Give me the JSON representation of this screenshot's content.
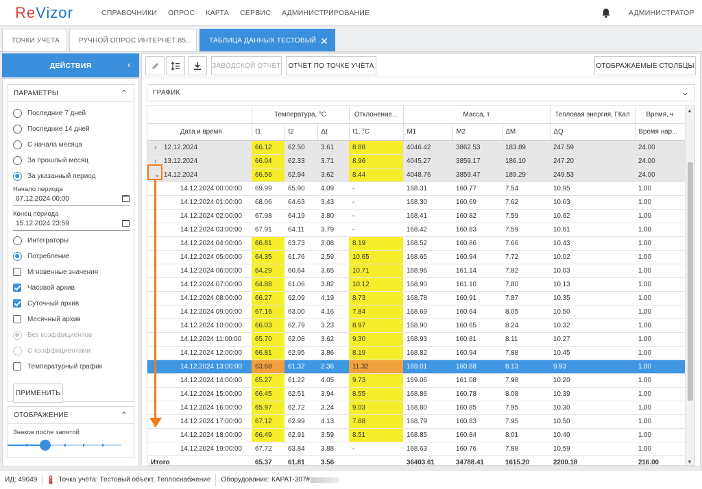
{
  "app": {
    "logo_re": "Re",
    "logo_rest": "Vizor"
  },
  "nav": [
    "СПРАВОЧНИКИ",
    "ОПРОС",
    "КАРТА",
    "СЕРВИС",
    "АДМИНИСТРИРОВАНИЕ"
  ],
  "user": "АДМИНИСТРАТОР",
  "tabs": [
    {
      "label": "ТОЧКИ УЧЕТА"
    },
    {
      "label": "РУЧНОЙ ОПРОС ИНТЕРНЕТ 85..."
    },
    {
      "label": "ТАБЛИЦА ДАННЫХ ТЕСТОВЫЙ ...",
      "active": true
    }
  ],
  "sidebar": {
    "actions_label": "ДЕЙСТВИЯ",
    "params_title": "ПАРАМЕТРЫ",
    "periods": [
      "Последние 7 дней",
      "Последние 14 дней",
      "С начала месяца",
      "За прошлый месяц",
      "За указанный период"
    ],
    "selected_period": 4,
    "start_label": "Начало периода",
    "start_value": "07.12.2024 00:00",
    "end_label": "Конец периода",
    "end_value": "15.12.2024 23:59",
    "mode_options": [
      "Интеграторы",
      "Потребление"
    ],
    "selected_mode": 1,
    "checks": [
      {
        "label": "Мгновенные значения",
        "checked": false
      },
      {
        "label": "Часовой архив",
        "checked": true
      },
      {
        "label": "Суточный архив",
        "checked": true
      },
      {
        "label": "Месячный архив",
        "checked": false
      }
    ],
    "coef_options": [
      "Без коэффициентов",
      "С коэффициентами"
    ],
    "temp_graph_label": "Температурный график",
    "apply_label": "ПРИМЕНИТЬ",
    "display_title": "ОТОБРАЖЕНИЕ",
    "decimals_label": "Знаков после запятой",
    "decimals_slider_fraction": 0.33
  },
  "toolbar": {
    "factory_report": "ЗАВОДСКОЙ ОТЧЁТ",
    "point_report": "ОТЧЁТ ПО ТОЧКЕ УЧЁТА",
    "columns": "ОТОБРАЖАЕМЫЕ СТОЛБЦЫ"
  },
  "grafik_label": "ГРАФИК",
  "table": {
    "group_headers": [
      "",
      "Температура, °C",
      "Отклонение...",
      "Масса, т",
      "Тепловая энергия, ГКал",
      "Время, ч"
    ],
    "columns": [
      "Дата и время",
      "t1",
      "t2",
      "Δt",
      "t1, °C",
      "M1",
      "M2",
      "ΔM",
      "ΔQ",
      "Время нар..."
    ],
    "groups": [
      {
        "date": "12.12.2024",
        "expander": "›",
        "vals": [
          "66.12",
          "62.50",
          "3.61",
          "8.88",
          "4046.42",
          "3862.53",
          "183.89",
          "247.59",
          "24.00"
        ]
      },
      {
        "date": "13.12.2024",
        "expander": "›",
        "vals": [
          "66.04",
          "62.33",
          "3.71",
          "8.96",
          "4045.27",
          "3859.17",
          "186.10",
          "247.20",
          "24.00"
        ]
      },
      {
        "date": "14.12.2024",
        "expander": "⌄",
        "vals": [
          "66.56",
          "62.94",
          "3.62",
          "8.44",
          "4048.76",
          "3859.47",
          "189.29",
          "249.53",
          "24.00"
        ]
      }
    ],
    "rows": [
      {
        "dt": "14.12.2024 00:00:00",
        "vals": [
          "69.99",
          "65.90",
          "4.09",
          "-",
          "168.31",
          "160.77",
          "7.54",
          "10.95",
          "1.00"
        ],
        "hl": false
      },
      {
        "dt": "14.12.2024 01:00:00",
        "vals": [
          "68.06",
          "64.63",
          "3.43",
          "-",
          "168.30",
          "160.69",
          "7.62",
          "10.63",
          "1.00"
        ],
        "hl": false
      },
      {
        "dt": "14.12.2024 02:00:00",
        "vals": [
          "67.98",
          "64.19",
          "3.80",
          "-",
          "168.41",
          "160.82",
          "7.59",
          "10.62",
          "1.00"
        ],
        "hl": false
      },
      {
        "dt": "14.12.2024 03:00:00",
        "vals": [
          "67.91",
          "64.11",
          "3.79",
          "-",
          "168.42",
          "160.83",
          "7.59",
          "10.61",
          "1.00"
        ],
        "hl": false
      },
      {
        "dt": "14.12.2024 04:00:00",
        "vals": [
          "66.81",
          "63.73",
          "3.08",
          "8.19",
          "168.52",
          "160.86",
          "7.66",
          "10.43",
          "1.00"
        ],
        "hl": true
      },
      {
        "dt": "14.12.2024 05:00:00",
        "vals": [
          "64.35",
          "61.76",
          "2.59",
          "10.65",
          "168.65",
          "160.94",
          "7.72",
          "10.02",
          "1.00"
        ],
        "hl": true
      },
      {
        "dt": "14.12.2024 06:00:00",
        "vals": [
          "64.29",
          "60.64",
          "3.65",
          "10.71",
          "168.96",
          "161.14",
          "7.82",
          "10.03",
          "1.00"
        ],
        "hl": true
      },
      {
        "dt": "14.12.2024 07:00:00",
        "vals": [
          "64.88",
          "61.06",
          "3.82",
          "10.12",
          "168.90",
          "161.10",
          "7.80",
          "10.13",
          "1.00"
        ],
        "hl": true
      },
      {
        "dt": "14.12.2024 08:00:00",
        "vals": [
          "66.27",
          "62.09",
          "4.19",
          "8.73",
          "168.78",
          "160.91",
          "7.87",
          "10.35",
          "1.00"
        ],
        "hl": true
      },
      {
        "dt": "14.12.2024 09:00:00",
        "vals": [
          "67.16",
          "63.00",
          "4.16",
          "7.84",
          "168.69",
          "160.64",
          "8.05",
          "10.50",
          "1.00"
        ],
        "hl": true
      },
      {
        "dt": "14.12.2024 10:00:00",
        "vals": [
          "66.03",
          "62.79",
          "3.23",
          "8.97",
          "168.90",
          "160.65",
          "8.24",
          "10.32",
          "1.00"
        ],
        "hl": true
      },
      {
        "dt": "14.12.2024 11:00:00",
        "vals": [
          "65.70",
          "62.08",
          "3.62",
          "9.30",
          "168.93",
          "160.81",
          "8.11",
          "10.27",
          "1.00"
        ],
        "hl": true
      },
      {
        "dt": "14.12.2024 12:00:00",
        "vals": [
          "66.81",
          "62.95",
          "3.86",
          "8.19",
          "168.82",
          "160.94",
          "7.88",
          "10.45",
          "1.00"
        ],
        "hl": true
      },
      {
        "dt": "14.12.2024 13:00:00",
        "vals": [
          "63.68",
          "61.32",
          "2.36",
          "11.32",
          "169.01",
          "160.88",
          "8.13",
          "9.93",
          "1.00"
        ],
        "hl": true,
        "selected": true
      },
      {
        "dt": "14.12.2024 14:00:00",
        "vals": [
          "65.27",
          "61.22",
          "4.05",
          "9.73",
          "169.06",
          "161.08",
          "7.98",
          "10.20",
          "1.00"
        ],
        "hl": true
      },
      {
        "dt": "14.12.2024 15:00:00",
        "vals": [
          "66.45",
          "62.51",
          "3.94",
          "8.55",
          "168.86",
          "160.78",
          "8.08",
          "10.39",
          "1.00"
        ],
        "hl": true
      },
      {
        "dt": "14.12.2024 16:00:00",
        "vals": [
          "65.97",
          "62.72",
          "3.24",
          "9.03",
          "168.80",
          "160.85",
          "7.95",
          "10.30",
          "1.00"
        ],
        "hl": true
      },
      {
        "dt": "14.12.2024 17:00:00",
        "vals": [
          "67.12",
          "62.99",
          "4.13",
          "7.88",
          "168.79",
          "160.83",
          "7.95",
          "10.50",
          "1.00"
        ],
        "hl": true
      },
      {
        "dt": "14.12.2024 18:00:00",
        "vals": [
          "66.49",
          "62.91",
          "3.59",
          "8.51",
          "168.85",
          "160.84",
          "8.01",
          "10.40",
          "1.00"
        ],
        "hl": true
      },
      {
        "dt": "14.12.2024 19:00:00",
        "vals": [
          "67.72",
          "63.84",
          "3.88",
          "-",
          "168.63",
          "160.76",
          "7.88",
          "10.59",
          "1.00"
        ],
        "hl": false
      }
    ],
    "total_label": "Итого",
    "totals": [
      "65.37",
      "61.81",
      "3.56",
      "",
      "36403.61",
      "34788.41",
      "1615.20",
      "2200.18",
      "216.00"
    ]
  },
  "status": {
    "id": "ИД: 49049",
    "point": "Точка учёта: Тестовый объект, Теплоснабжение",
    "equipment": "Оборудование: КАРАТ-307#"
  },
  "colors": {
    "accent": "#3a8fdc",
    "highlight": "#f6ee2b",
    "selected_highlight": "#f3a13a",
    "annotation": "#ef7d1a",
    "logo_red": "#e23c3c"
  }
}
